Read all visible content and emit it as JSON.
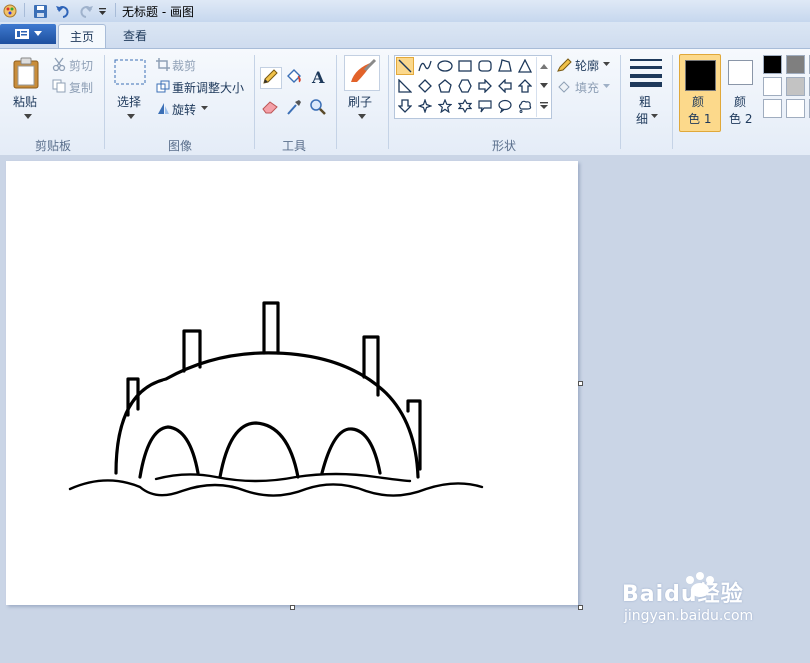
{
  "window": {
    "title": "无标题 - 画图"
  },
  "tabs": [
    {
      "label": "主页"
    },
    {
      "label": "查看"
    }
  ],
  "clipboard": {
    "paste": "粘贴",
    "cut": "剪切",
    "copy": "复制",
    "group": "剪贴板"
  },
  "image": {
    "select": "选择",
    "crop": "裁剪",
    "resize": "重新调整大小",
    "rotate": "旋转",
    "group": "图像"
  },
  "tools": {
    "group": "工具"
  },
  "brushes": {
    "label": "刷子"
  },
  "shapes": {
    "group": "形状",
    "outline": "轮廓",
    "fill": "填充"
  },
  "size": {
    "label_1": "粗",
    "label_2": "细"
  },
  "colors": {
    "color1_1": "颜",
    "color1_2": "色 1",
    "color2_1": "颜",
    "color2_2": "色 2",
    "color1": "#000000",
    "color2": "#ffffff",
    "palette": [
      "#000000",
      "#7f7f7f",
      "#880015",
      "#ffffff",
      "#c3c3c3",
      "#b97a57",
      "#ffffff",
      "#ffffff",
      "#ffffff"
    ]
  },
  "watermark": {
    "brand": "Baidu经验",
    "url": "jingyan.baidu.com"
  }
}
